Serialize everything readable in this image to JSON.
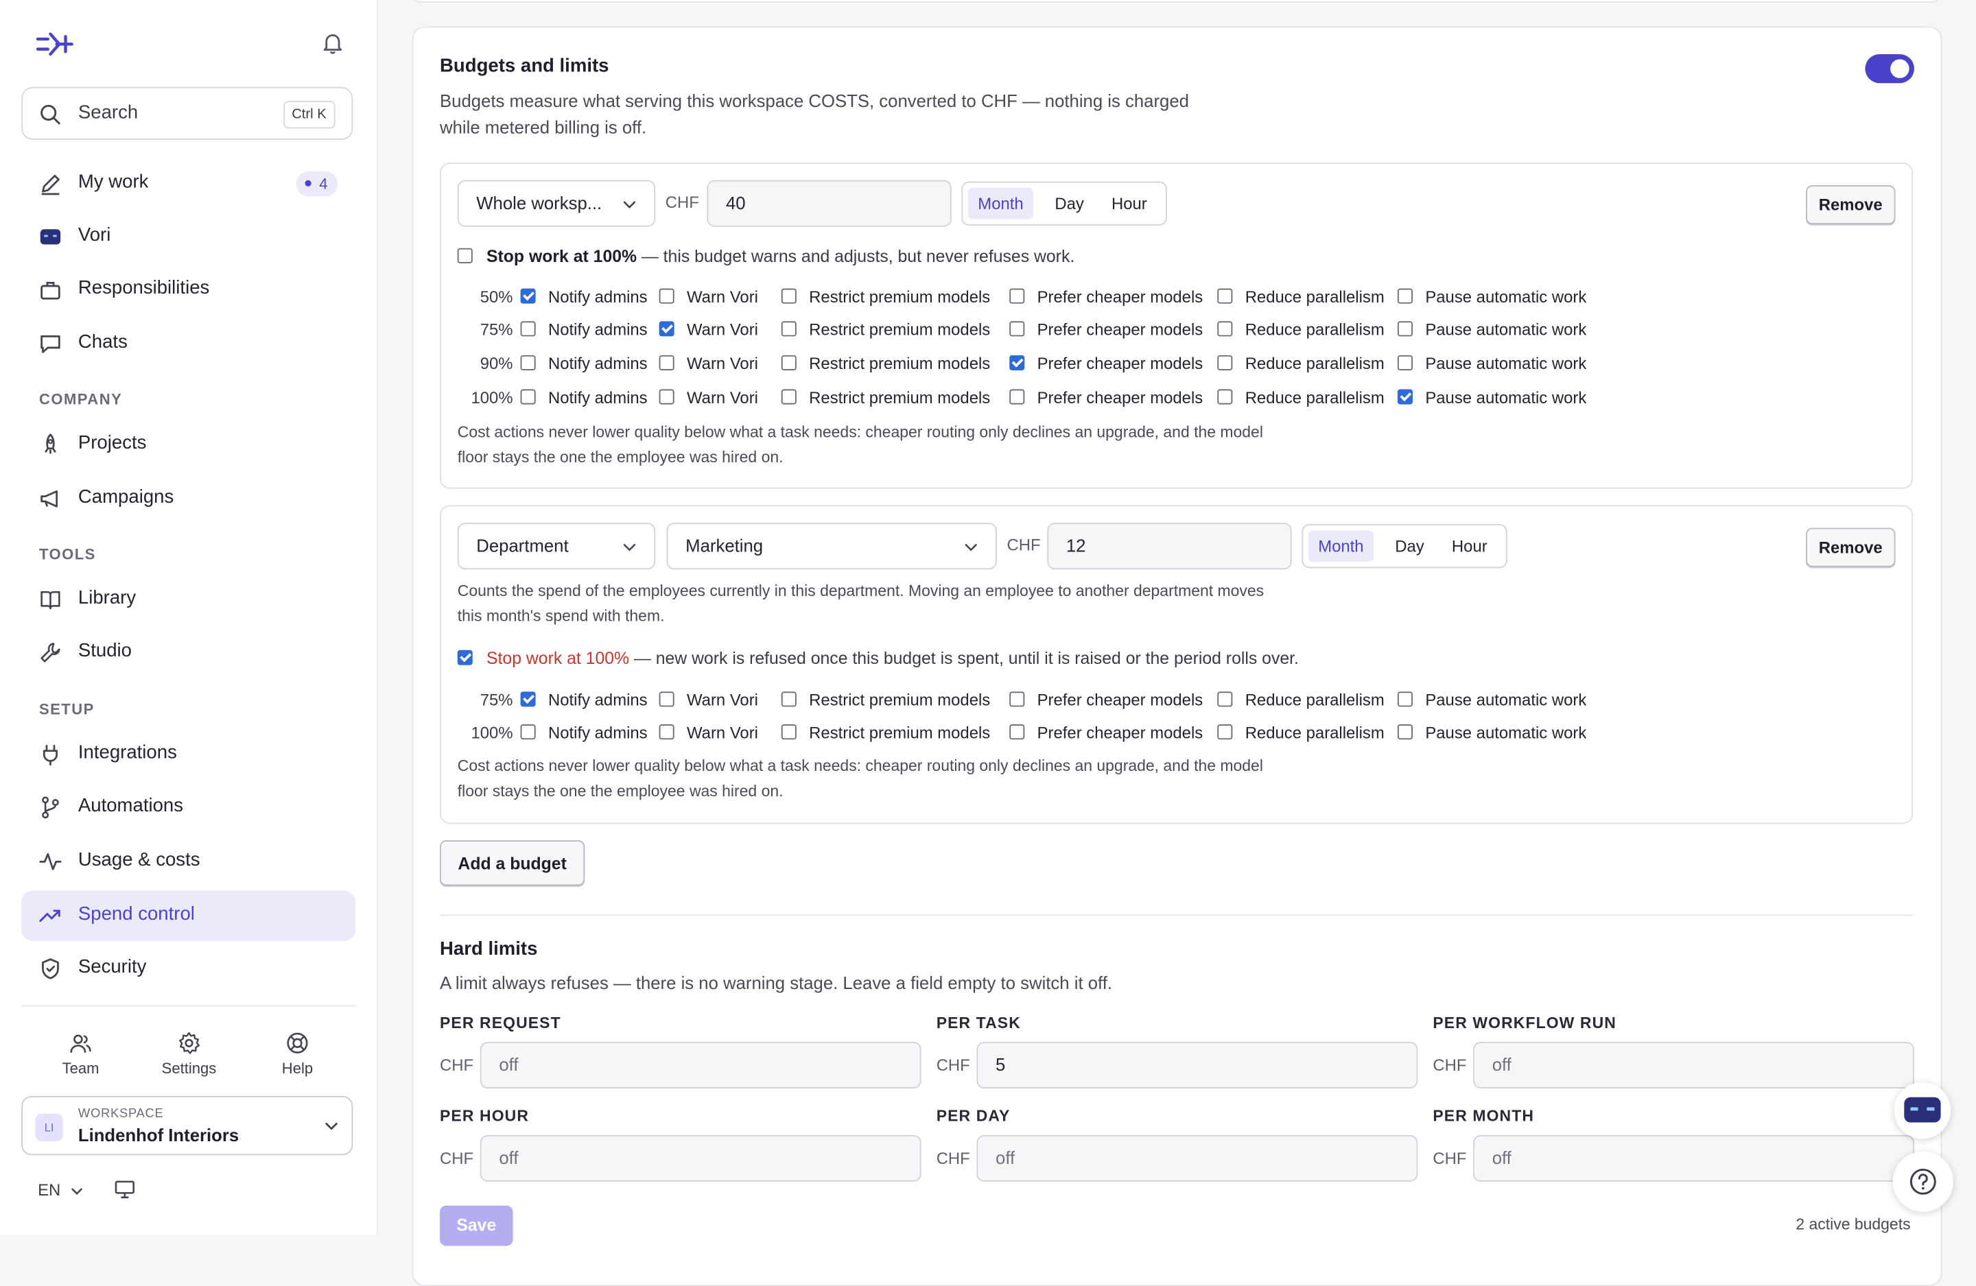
{
  "sidebar": {
    "search": {
      "label": "Search",
      "shortcut": "Ctrl K"
    },
    "main_items": [
      {
        "label": "My work",
        "badge": "4",
        "icon": "pencil-icon"
      },
      {
        "label": "Vori",
        "icon": "bot-icon"
      },
      {
        "label": "Responsibilities",
        "icon": "briefcase-icon"
      },
      {
        "label": "Chats",
        "icon": "chat-icon"
      }
    ],
    "sections": {
      "company": "COMPANY",
      "tools": "TOOLS",
      "setup": "SETUP"
    },
    "company_items": [
      {
        "label": "Projects",
        "icon": "rocket-icon"
      },
      {
        "label": "Campaigns",
        "icon": "megaphone-icon"
      }
    ],
    "tools_items": [
      {
        "label": "Library",
        "icon": "book-icon"
      },
      {
        "label": "Studio",
        "icon": "wrench-icon"
      }
    ],
    "setup_items": [
      {
        "label": "Integrations",
        "icon": "plug-icon"
      },
      {
        "label": "Automations",
        "icon": "branch-icon"
      },
      {
        "label": "Usage & costs",
        "icon": "activity-icon"
      },
      {
        "label": "Spend control",
        "icon": "trend-icon",
        "active": true
      },
      {
        "label": "Security",
        "icon": "shield-icon"
      }
    ],
    "utilities": [
      {
        "label": "Team",
        "icon": "team-icon"
      },
      {
        "label": "Settings",
        "icon": "gear-icon"
      },
      {
        "label": "Help",
        "icon": "lifebuoy-icon"
      }
    ],
    "workspace": {
      "caption": "WORKSPACE",
      "initials": "LI",
      "name": "Lindenhof Interiors"
    },
    "language": "EN"
  },
  "budgets_card": {
    "title": "Budgets and limits",
    "description": "Budgets measure what serving this workspace COSTS, converted to CHF — nothing is charged while metered billing is off.",
    "enabled": true,
    "currency": "CHF",
    "period_options": [
      "Month",
      "Day",
      "Hour"
    ],
    "remove_label": "Remove",
    "action_labels": [
      "Notify admins",
      "Warn Vori",
      "Restrict premium models",
      "Prefer cheaper models",
      "Reduce parallelism",
      "Pause automatic work"
    ],
    "cost_note": "Cost actions never lower quality below what a task needs: cheaper routing only declines an upgrade, and the model floor stays the one the employee was hired on.",
    "budgets": [
      {
        "scope": "Whole worksp...",
        "amount": "40",
        "period": "Month",
        "stop_work": false,
        "stop_label": "Stop work at 100%",
        "stop_text": " — this budget warns and adjusts, but never refuses work.",
        "thresholds": [
          {
            "pct": "50%",
            "checked": [
              true,
              false,
              false,
              false,
              false,
              false
            ]
          },
          {
            "pct": "75%",
            "checked": [
              false,
              true,
              false,
              false,
              false,
              false
            ]
          },
          {
            "pct": "90%",
            "checked": [
              false,
              false,
              false,
              true,
              false,
              false
            ]
          },
          {
            "pct": "100%",
            "checked": [
              false,
              false,
              false,
              false,
              false,
              true
            ]
          }
        ]
      },
      {
        "scope": "Department",
        "department": "Marketing",
        "amount": "12",
        "period": "Month",
        "department_note": "Counts the spend of the employees currently in this department. Moving an employee to another department moves this month's spend with them.",
        "stop_work": true,
        "stop_label": "Stop work at 100%",
        "stop_text": " — new work is refused once this budget is spent, until it is raised or the period rolls over.",
        "thresholds": [
          {
            "pct": "75%",
            "checked": [
              true,
              false,
              false,
              false,
              false,
              false
            ]
          },
          {
            "pct": "100%",
            "checked": [
              false,
              false,
              false,
              false,
              false,
              false
            ]
          }
        ]
      }
    ],
    "add_budget_label": "Add a budget"
  },
  "hard_limits": {
    "title": "Hard limits",
    "description": "A limit always refuses — there is no warning stage. Leave a field empty to switch it off.",
    "fields": [
      {
        "label": "PER REQUEST",
        "value": "off"
      },
      {
        "label": "PER TASK",
        "value": "5"
      },
      {
        "label": "PER WORKFLOW RUN",
        "value": "off"
      },
      {
        "label": "PER HOUR",
        "value": "off"
      },
      {
        "label": "PER DAY",
        "value": "off"
      },
      {
        "label": "PER MONTH",
        "value": "off"
      }
    ],
    "save_label": "Save",
    "active_count": "2 active budgets"
  },
  "colors": {
    "accent": "#4a43c9",
    "checkbox": "#2f6bd8",
    "danger": "#c5372c"
  }
}
